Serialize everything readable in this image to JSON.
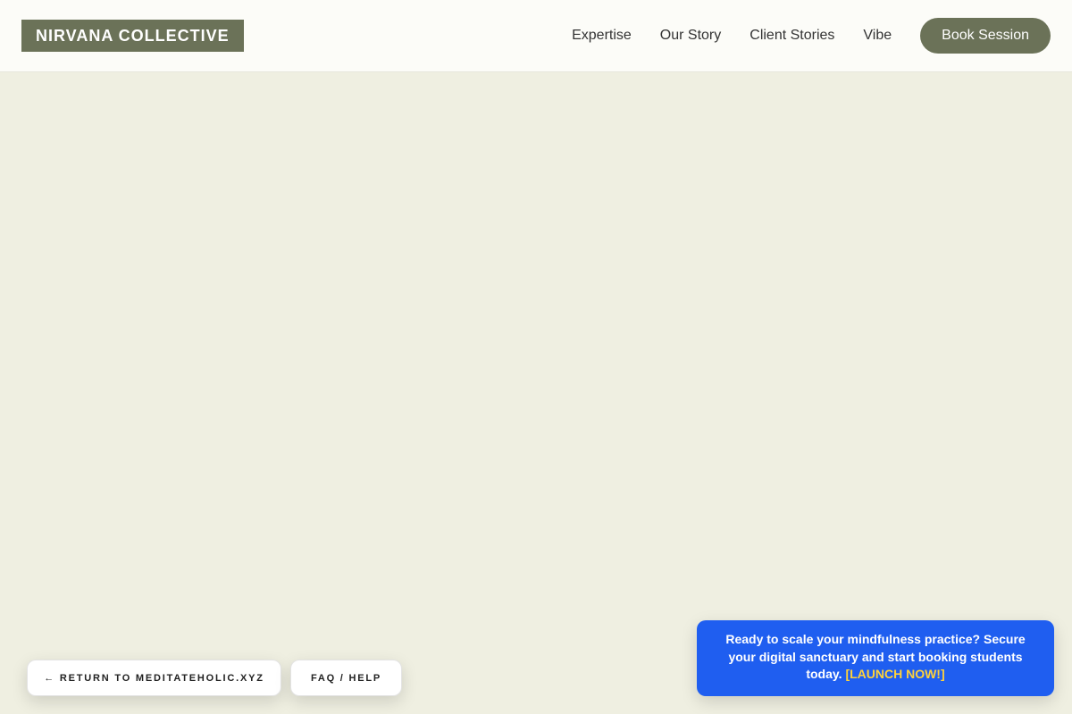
{
  "header": {
    "logo": "NIRVANA COLLECTIVE",
    "nav": {
      "items": [
        {
          "label": "Expertise"
        },
        {
          "label": "Our Story"
        },
        {
          "label": "Client Stories"
        },
        {
          "label": "Vibe"
        }
      ],
      "cta_label": "Book Session"
    }
  },
  "footer_actions": {
    "return_label": "← RETURN TO MEDITATEHOLIC.XYZ",
    "faq_label": "FAQ / HELP"
  },
  "cta_banner": {
    "text": "Ready to scale your mindfulness practice? Secure your digital sanctuary and start booking students today.",
    "link_label": "[LAUNCH NOW!]"
  },
  "colors": {
    "page_background": "#efefe1",
    "header_background": "#fcfcf8",
    "brand": "#6b7258",
    "banner": "#1f5ef0",
    "banner_link": "#ffd23a"
  }
}
